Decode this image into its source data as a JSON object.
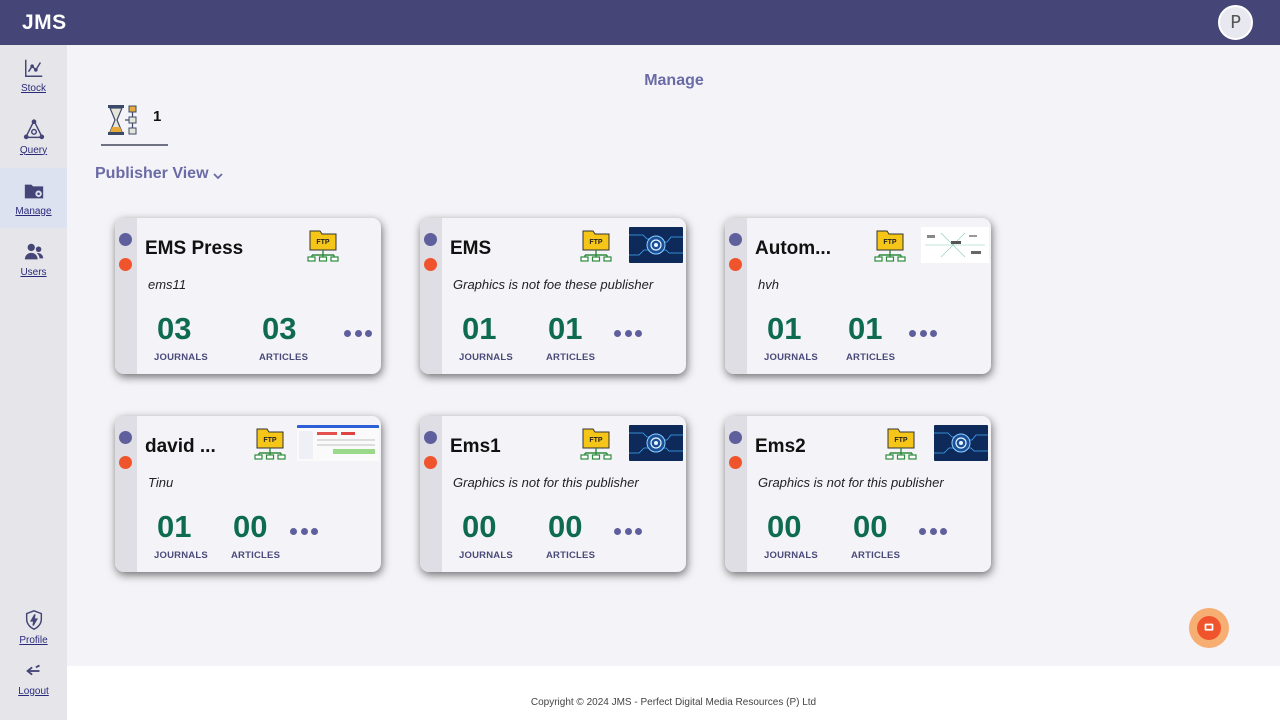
{
  "app": {
    "brand": "JMS",
    "avatar_initial": "P"
  },
  "sidebar": {
    "items": [
      {
        "label": "Stock",
        "icon": "chart-icon",
        "active": false
      },
      {
        "label": "Query",
        "icon": "query-icon",
        "active": false
      },
      {
        "label": "Manage",
        "icon": "folder-gear-icon",
        "active": true
      },
      {
        "label": "Users",
        "icon": "users-icon",
        "active": false
      }
    ],
    "bottom": [
      {
        "label": "Profile",
        "icon": "shield-bolt-icon"
      },
      {
        "label": "Logout",
        "icon": "logout-icon"
      }
    ]
  },
  "main": {
    "title": "Manage",
    "status": {
      "icon": "hourglass-workflow-icon",
      "count": "1"
    },
    "view_selector": {
      "label": "Publisher View",
      "icon": "chevron-down-icon"
    }
  },
  "cards": [
    {
      "name": "EMS Press",
      "description": "ems11",
      "journals": "03",
      "articles": "03",
      "journals_label": "JOURNALS",
      "articles_label": "ARTICLES",
      "ftp": "FTP",
      "thumbnail": "none"
    },
    {
      "name": "EMS",
      "description": "Graphics is not foe these publisher",
      "journals": "01",
      "articles": "01",
      "journals_label": "JOURNALS",
      "articles_label": "ARTICLES",
      "ftp": "FTP",
      "thumbnail": "circuit"
    },
    {
      "name": "Autom...",
      "description": "hvh",
      "journals": "01",
      "articles": "01",
      "journals_label": "JOURNALS",
      "articles_label": "ARTICLES",
      "ftp": "FTP",
      "thumbnail": "diagram"
    },
    {
      "name": "david ...",
      "description": "Tinu",
      "journals": "01",
      "articles": "00",
      "journals_label": "JOURNALS",
      "articles_label": "ARTICLES",
      "ftp": "FTP",
      "thumbnail": "screenshot"
    },
    {
      "name": "Ems1",
      "description": "Graphics is not for this publisher",
      "journals": "00",
      "articles": "00",
      "journals_label": "JOURNALS",
      "articles_label": "ARTICLES",
      "ftp": "FTP",
      "thumbnail": "circuit"
    },
    {
      "name": "Ems2",
      "description": "Graphics is not for this publisher",
      "journals": "00",
      "articles": "00",
      "journals_label": "JOURNALS",
      "articles_label": "ARTICLES",
      "ftp": "FTP",
      "thumbnail": "circuit"
    }
  ],
  "footer": {
    "copyright": "Copyright © 2024 JMS - Perfect Digital Media Resources (P) Ltd"
  },
  "colors": {
    "topbar": "#454577",
    "accent": "#6a6aa6",
    "stat": "#0e6b52",
    "dot_blue": "#5f5f9e",
    "dot_red": "#f0542c"
  }
}
